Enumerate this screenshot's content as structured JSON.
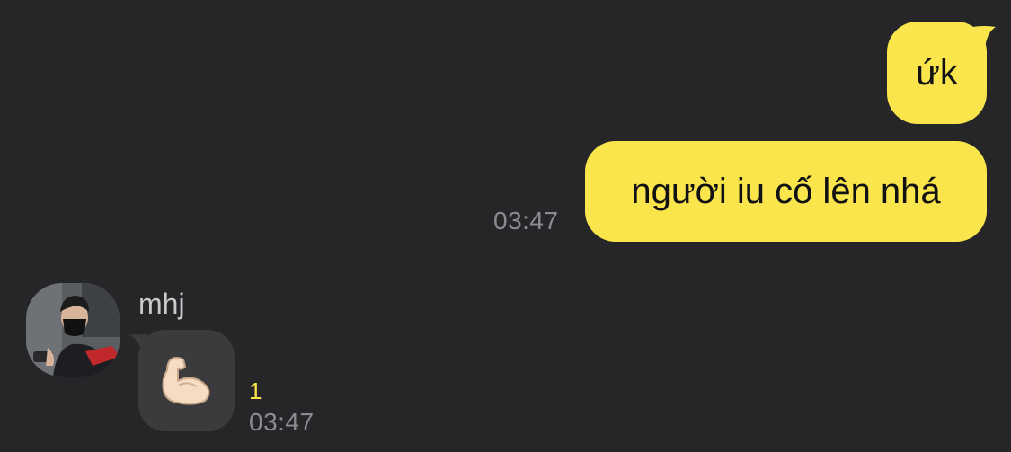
{
  "messages": {
    "outgoing": [
      {
        "text": "ứk"
      },
      {
        "text": "người iu cố lên nhá",
        "time": "03:47"
      }
    ],
    "incoming": {
      "sender_name": "mhj",
      "sticker": "flexed-biceps-emoji",
      "unread_count": "1",
      "time": "03:47"
    }
  },
  "colors": {
    "background": "#262628",
    "my_bubble": "#fae54c",
    "their_bubble": "#3b3b3e",
    "unread": "#fae54c",
    "timestamp": "#8c8c90"
  }
}
